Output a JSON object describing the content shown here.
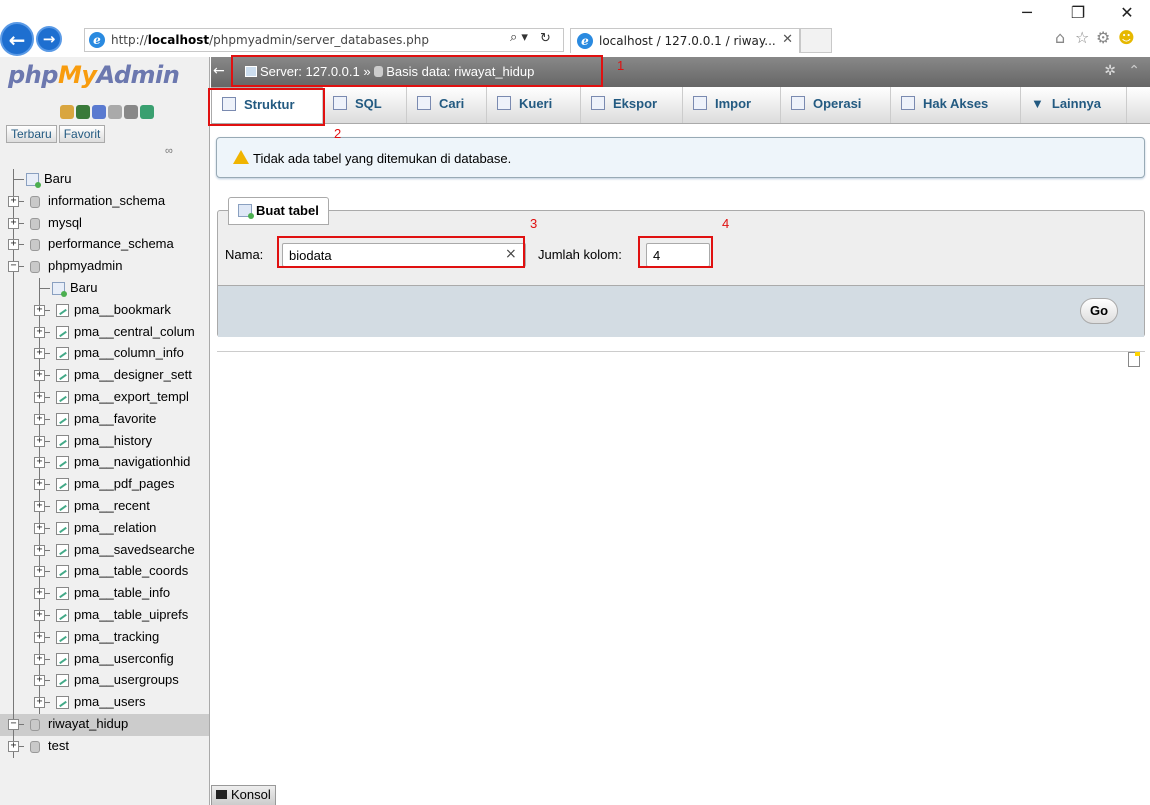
{
  "window": {
    "minimize_glyph": "─",
    "restore_glyph": "❐",
    "close_glyph": "✕"
  },
  "browser": {
    "back_glyph": "←",
    "forward_glyph": "→",
    "url_prefix": "http://",
    "url_host": "localhost",
    "url_path": "/phpmyadmin/server_databases.php",
    "search_glyph": "⌕ ▾",
    "refresh_glyph": "↻",
    "tab_title": "localhost / 127.0.0.1 / riway...",
    "tab_close": "✕",
    "toolbar_home": "⌂",
    "toolbar_star": "☆",
    "toolbar_gear": "⚙",
    "toolbar_smiley": "☻"
  },
  "nav": {
    "logo_php": "php",
    "logo_my": "My",
    "logo_admin": "Admin",
    "icon_colors": [
      "#d9a640",
      "#3a7a3a",
      "#5a7ad0",
      "#aaaaaa",
      "#888888",
      "#3aa070"
    ],
    "tabs": [
      "Terbaru",
      "Favorit"
    ],
    "link_glyph": "∞",
    "tree": [
      {
        "label": "Baru",
        "kind": "new",
        "level": 0
      },
      {
        "label": "information_schema",
        "kind": "db",
        "level": 0
      },
      {
        "label": "mysql",
        "kind": "db",
        "level": 0
      },
      {
        "label": "performance_schema",
        "kind": "db",
        "level": 0
      },
      {
        "label": "phpmyadmin",
        "kind": "db-open",
        "level": 0
      },
      {
        "label": "Baru",
        "kind": "new",
        "level": 1
      },
      {
        "label": "pma__bookmark",
        "kind": "table",
        "level": 1
      },
      {
        "label": "pma__central_colum",
        "kind": "table",
        "level": 1
      },
      {
        "label": "pma__column_info",
        "kind": "table",
        "level": 1
      },
      {
        "label": "pma__designer_sett",
        "kind": "table",
        "level": 1
      },
      {
        "label": "pma__export_templ",
        "kind": "table",
        "level": 1
      },
      {
        "label": "pma__favorite",
        "kind": "table",
        "level": 1
      },
      {
        "label": "pma__history",
        "kind": "table",
        "level": 1
      },
      {
        "label": "pma__navigationhid",
        "kind": "table",
        "level": 1
      },
      {
        "label": "pma__pdf_pages",
        "kind": "table",
        "level": 1
      },
      {
        "label": "pma__recent",
        "kind": "table",
        "level": 1
      },
      {
        "label": "pma__relation",
        "kind": "table",
        "level": 1
      },
      {
        "label": "pma__savedsearche",
        "kind": "table",
        "level": 1
      },
      {
        "label": "pma__table_coords",
        "kind": "table",
        "level": 1
      },
      {
        "label": "pma__table_info",
        "kind": "table",
        "level": 1
      },
      {
        "label": "pma__table_uiprefs",
        "kind": "table",
        "level": 1
      },
      {
        "label": "pma__tracking",
        "kind": "table",
        "level": 1
      },
      {
        "label": "pma__userconfig",
        "kind": "table",
        "level": 1
      },
      {
        "label": "pma__usergroups",
        "kind": "table",
        "level": 1
      },
      {
        "label": "pma__users",
        "kind": "table",
        "level": 1
      },
      {
        "label": "riwayat_hidup",
        "kind": "db-selected",
        "level": 0
      },
      {
        "label": "test",
        "kind": "db",
        "level": 0
      }
    ]
  },
  "topbar": {
    "collapse_glyph": "←",
    "server_label": "Server: 127.0.0.1",
    "separator": "»",
    "database_label": "Basis data: riwayat_hidup",
    "gear_glyph": "✲",
    "up_glyph": "⌃"
  },
  "menu": [
    {
      "label": "Struktur",
      "active": true
    },
    {
      "label": "SQL",
      "active": false
    },
    {
      "label": "Cari",
      "active": false
    },
    {
      "label": "Kueri",
      "active": false
    },
    {
      "label": "Ekspor",
      "active": false
    },
    {
      "label": "Impor",
      "active": false
    },
    {
      "label": "Operasi",
      "active": false
    },
    {
      "label": "Hak Akses",
      "active": false
    },
    {
      "label": "Lainnya",
      "active": false
    }
  ],
  "notice": {
    "text": "Tidak ada tabel yang ditemukan di database."
  },
  "create_table": {
    "legend": "Buat tabel",
    "name_label": "Nama:",
    "name_value": "biodata",
    "clear_glyph": "×",
    "columns_label": "Jumlah kolom:",
    "columns_value": "4",
    "go_label": "Go"
  },
  "console": {
    "label": "Konsol"
  },
  "annotations": [
    "1",
    "2",
    "3",
    "4"
  ],
  "colors": {
    "annotation": "#e01010",
    "link": "#235a81",
    "logo_php": "#6c78af",
    "logo_my": "#f89c0e"
  }
}
